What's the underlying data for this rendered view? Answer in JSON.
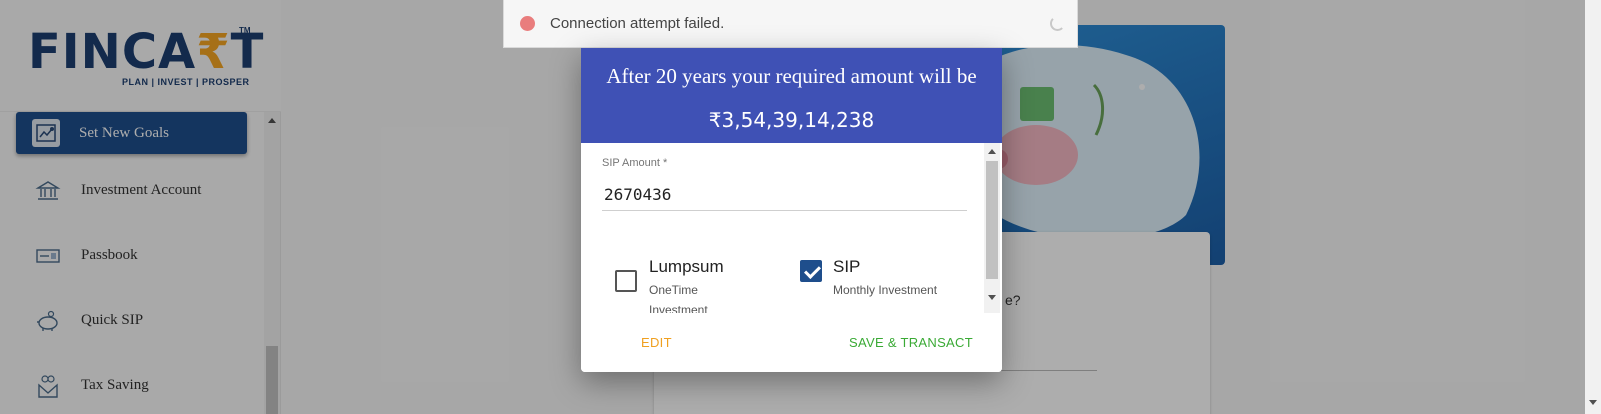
{
  "brand": {
    "logo_text": "FINCA",
    "logo_rupee": "₹",
    "logo_end": "T",
    "logo_tm": "TM",
    "tagline": "PLAN | INVEST | PROSPER"
  },
  "sidebar": {
    "items": [
      {
        "label": "Set New Goals",
        "icon": "goals-icon"
      },
      {
        "label": "Investment Account",
        "icon": "bank-icon"
      },
      {
        "label": "Passbook",
        "icon": "passbook-icon"
      },
      {
        "label": "Quick SIP",
        "icon": "piggy-bank-icon"
      },
      {
        "label": "Tax Saving",
        "icon": "tax-saving-icon"
      }
    ]
  },
  "toast": {
    "message": "Connection attempt failed.",
    "status_color": "#e97d7d"
  },
  "background_card": {
    "text": "e?"
  },
  "modal": {
    "header_line1": "After 20 years your required amount will be",
    "amount": "₹3,54,39,14,238",
    "sip_label": "SIP Amount *",
    "sip_value": "2670436",
    "options": [
      {
        "title": "Lumpsum",
        "subtitle": "OneTime Investment",
        "checked": false
      },
      {
        "title": "SIP",
        "subtitle": "Monthly Investment",
        "checked": true
      }
    ],
    "edit_label": "EDIT",
    "save_label": "SAVE & TRANSACT"
  },
  "colors": {
    "primary": "#3f51b5",
    "sidebar_active": "#1e4e8c",
    "edit": "#f0a020",
    "save": "#3aaa35"
  }
}
